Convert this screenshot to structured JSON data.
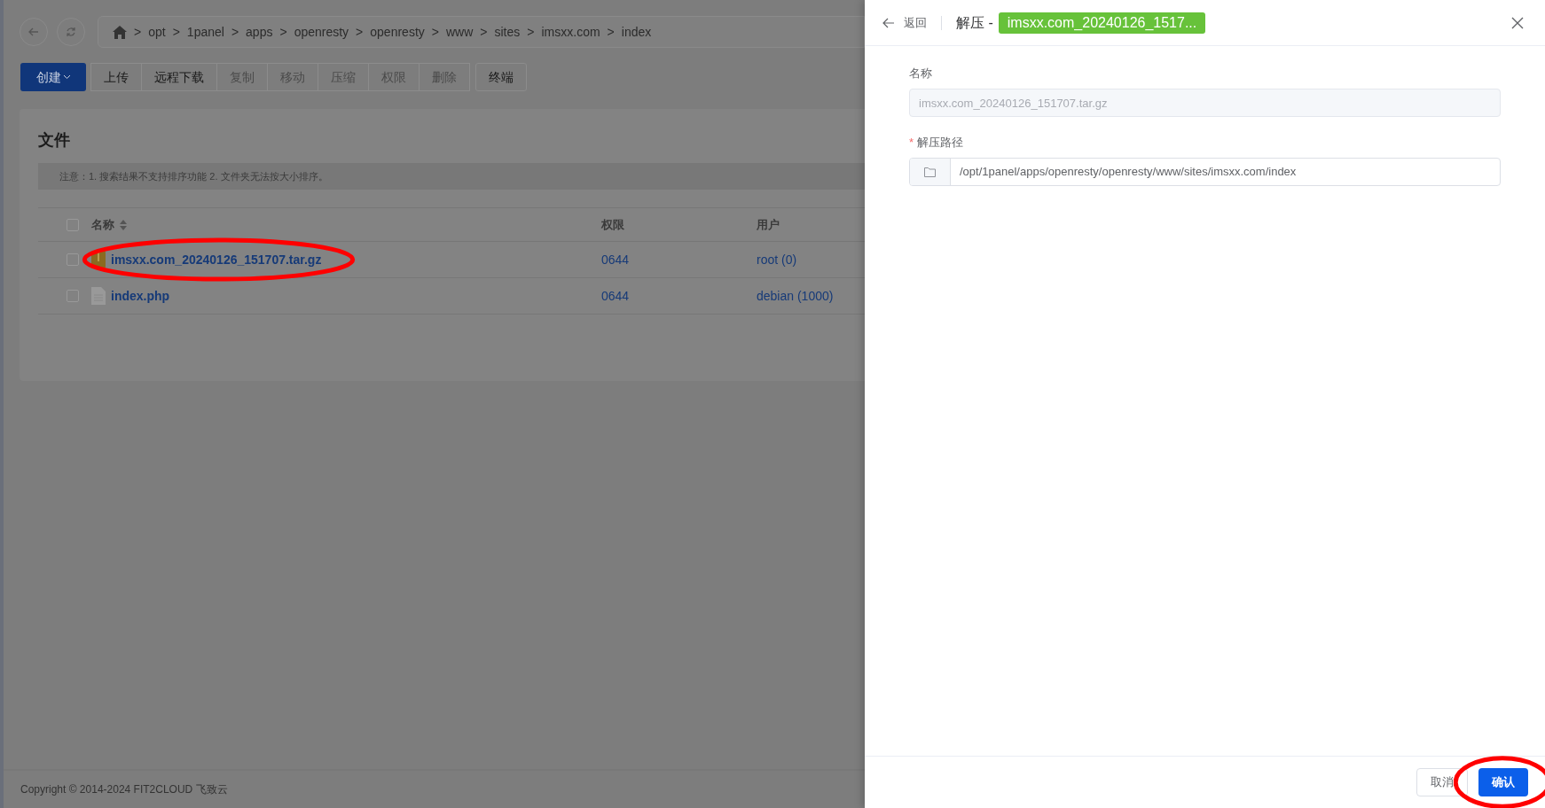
{
  "nav": {
    "breadcrumb": [
      "opt",
      "1panel",
      "apps",
      "openresty",
      "openresty",
      "www",
      "sites",
      "imsxx.com",
      "index"
    ],
    "separator": ">"
  },
  "toolbar": [
    {
      "label": "创建",
      "kind": "primary",
      "disabled": false
    },
    {
      "label": "上传",
      "kind": "group",
      "disabled": false
    },
    {
      "label": "远程下载",
      "kind": "group",
      "disabled": false
    },
    {
      "label": "复制",
      "kind": "group",
      "disabled": true
    },
    {
      "label": "移动",
      "kind": "group",
      "disabled": true
    },
    {
      "label": "压缩",
      "kind": "group",
      "disabled": true
    },
    {
      "label": "权限",
      "kind": "group",
      "disabled": true
    },
    {
      "label": "删除",
      "kind": "group",
      "disabled": true
    },
    {
      "label": "终端",
      "kind": "single",
      "disabled": false
    }
  ],
  "files": {
    "title": "文件",
    "notice": "注意：1. 搜索结果不支持排序功能 2. 文件夹无法按大小排序。",
    "columns": [
      "名称",
      "权限",
      "用户"
    ],
    "select_all_checked": false,
    "rows": [
      {
        "name": "imsxx.com_20240126_151707.tar.gz",
        "kind": "archive",
        "mode": "0644",
        "user": "root (0)",
        "checked": false,
        "circled": true
      },
      {
        "name": "index.php",
        "kind": "file",
        "mode": "0644",
        "user": "debian (1000)",
        "checked": false,
        "circled": false
      }
    ]
  },
  "footer": "Copyright © 2014-2024 FIT2CLOUD 飞致云",
  "drawer": {
    "back": "返回",
    "title": "解压 -",
    "tag": "imsxx.com_20240126_1517...",
    "fields": [
      {
        "label": "名称",
        "value": "imsxx.com_20240126_151707.tar.gz",
        "disabled": true,
        "kind": "text"
      },
      {
        "label": "解压路径",
        "required": true,
        "required_mark": "*",
        "value": "/opt/1panel/apps/openresty/openresty/www/sites/imsxx.com/index",
        "disabled": false,
        "kind": "folder"
      }
    ],
    "buttons": [
      {
        "label": "取消",
        "kind": "default",
        "circled": false
      },
      {
        "label": "确认",
        "kind": "primary",
        "circled": true
      }
    ]
  }
}
